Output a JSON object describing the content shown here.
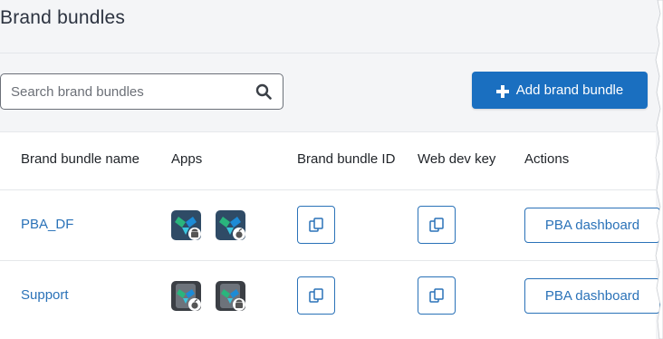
{
  "page": {
    "title": "Brand bundles"
  },
  "search": {
    "placeholder": "Search brand bundles",
    "value": ""
  },
  "toolbar": {
    "add_label": "Add brand bundle"
  },
  "table": {
    "headers": {
      "name": "Brand bundle name",
      "apps": "Apps",
      "id": "Brand bundle ID",
      "devkey": "Web dev key",
      "actions": "Actions"
    },
    "rows": [
      {
        "name": "PBA_DF",
        "apps": [
          "android",
          "apple"
        ],
        "action_label": "PBA dashboard"
      },
      {
        "name": "Support",
        "apps": [
          "apple",
          "android"
        ],
        "action_label": "PBA dashboard"
      }
    ]
  },
  "colors": {
    "primary": "#1a6fc0",
    "link": "#2a72b8",
    "background": "#f4f5f7"
  },
  "icons": [
    "search-icon",
    "plus-icon",
    "copy-icon",
    "android-icon",
    "apple-icon",
    "app-logo-icon"
  ]
}
